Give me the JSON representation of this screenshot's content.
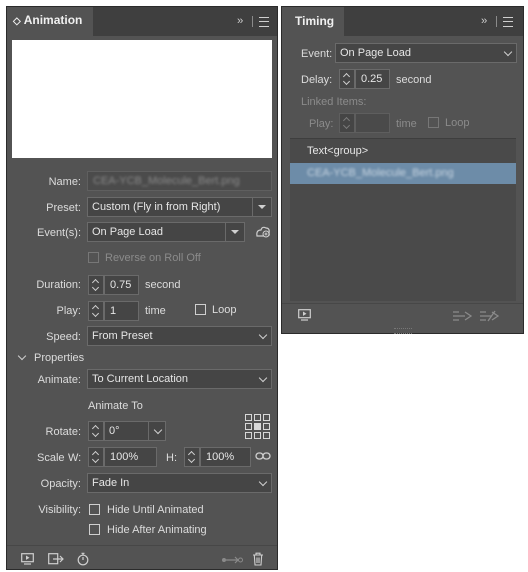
{
  "animation_panel": {
    "title": "Animation",
    "collapse_glyph": "◇",
    "name_label": "Name:",
    "name_value": "CEA-YCB_Molecule_Bert.png",
    "preset_label": "Preset:",
    "preset_value": "Custom (Fly in from Right)",
    "events_label": "Event(s):",
    "events_value": "On Page Load",
    "reverse_label": "Reverse on Roll Off",
    "duration_label": "Duration:",
    "duration_value": "0.75",
    "duration_unit": "second",
    "play_label": "Play:",
    "play_value": "1",
    "play_unit": "time",
    "loop_label": "Loop",
    "speed_label": "Speed:",
    "speed_value": "From Preset",
    "properties_label": "Properties",
    "animate_label": "Animate:",
    "animate_value": "To Current Location",
    "animate_to_label": "Animate To",
    "rotate_label": "Rotate:",
    "rotate_value": "0°",
    "scale_label": "Scale",
    "w_label": "W:",
    "w_value": "100%",
    "h_label": "H:",
    "h_value": "100%",
    "opacity_label": "Opacity:",
    "opacity_value": "Fade In",
    "visibility_label": "Visibility:",
    "hide_until_label": "Hide Until Animated",
    "hide_after_label": "Hide After Animating"
  },
  "timing_panel": {
    "title": "Timing",
    "event_label": "Event:",
    "event_value": "On Page Load",
    "delay_label": "Delay:",
    "delay_value": "0.25",
    "delay_unit": "second",
    "linked_label": "Linked Items:",
    "play_label": "Play:",
    "play_unit": "time",
    "loop_label": "Loop",
    "items": [
      "Text<group>",
      "CEA-YCB_Molecule_Bert.png"
    ]
  },
  "icons": {
    "panel_menu": "panel-menu-icon",
    "preview": "preview-icon",
    "events_add": "add-event-icon",
    "link": "constrain-proportions-icon",
    "delete": "trash-icon"
  }
}
